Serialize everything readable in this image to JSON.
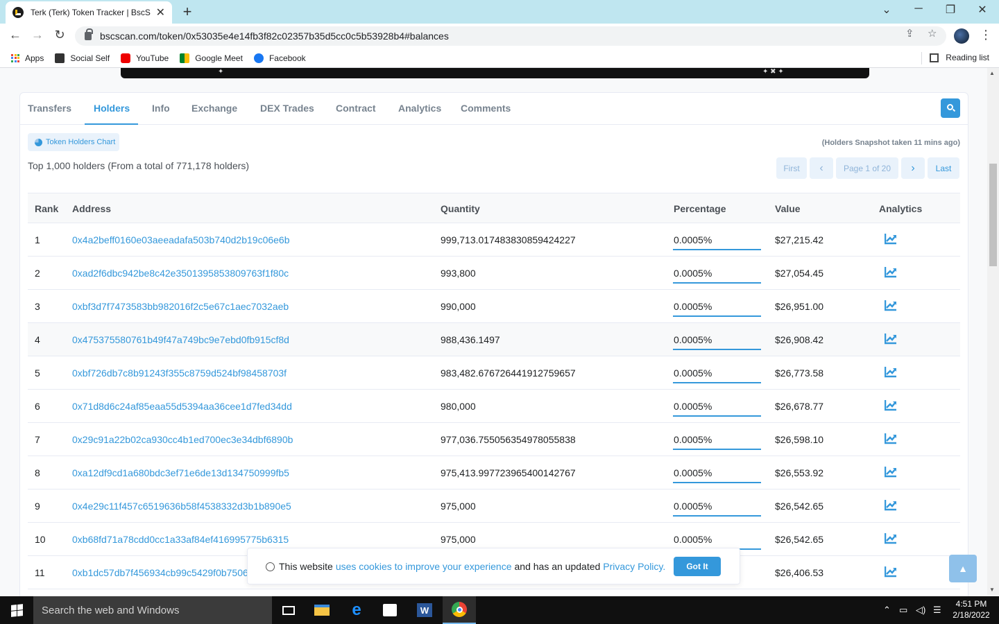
{
  "browser": {
    "tab_title": "Terk (Terk) Token Tracker | BscScan",
    "new_tab": "+",
    "close_tab": "✕",
    "url": "bscscan.com/token/0x53035e4e14fb3f82c02357b35d5cc0c5b53928b4#balances",
    "bookmarks": [
      {
        "label": "Apps"
      },
      {
        "label": "Social Self"
      },
      {
        "label": "YouTube"
      },
      {
        "label": "Google Meet"
      },
      {
        "label": "Facebook"
      }
    ],
    "reading_list": "Reading list"
  },
  "page_tabs": [
    "Transfers",
    "Holders",
    "Info",
    "Exchange",
    "DEX Trades",
    "Contract",
    "Analytics",
    "Comments"
  ],
  "active_tab": "Holders",
  "holders": {
    "chart_button": "Token Holders Chart",
    "snapshot_note": "(Holders Snapshot taken 11 mins ago)",
    "total_text": "Top 1,000 holders (From a total of 771,178 holders)",
    "pagination": {
      "first": "First",
      "prev": "‹",
      "page": "Page 1 of 20",
      "next": "›",
      "last": "Last"
    },
    "columns": [
      "Rank",
      "Address",
      "Quantity",
      "Percentage",
      "Value",
      "Analytics"
    ],
    "rows": [
      {
        "rank": "1",
        "address": "0x4a2beff0160e03aeeadafa503b740d2b19c06e6b",
        "quantity": "999,713.017483830859424227",
        "percentage": "0.0005%",
        "value": "$27,215.42"
      },
      {
        "rank": "2",
        "address": "0xad2f6dbc942be8c42e3501395853809763f1f80c",
        "quantity": "993,800",
        "percentage": "0.0005%",
        "value": "$27,054.45"
      },
      {
        "rank": "3",
        "address": "0xbf3d7f7473583bb982016f2c5e67c1aec7032aeb",
        "quantity": "990,000",
        "percentage": "0.0005%",
        "value": "$26,951.00"
      },
      {
        "rank": "4",
        "address": "0x475375580761b49f47a749bc9e7ebd0fb915cf8d",
        "quantity": "988,436.1497",
        "percentage": "0.0005%",
        "value": "$26,908.42"
      },
      {
        "rank": "5",
        "address": "0xbf726db7c8b91243f355c8759d524bf98458703f",
        "quantity": "983,482.676726441912759657",
        "percentage": "0.0005%",
        "value": "$26,773.58"
      },
      {
        "rank": "6",
        "address": "0x71d8d6c24af85eaa55d5394aa36cee1d7fed34dd",
        "quantity": "980,000",
        "percentage": "0.0005%",
        "value": "$26,678.77"
      },
      {
        "rank": "7",
        "address": "0x29c91a22b02ca930cc4b1ed700ec3e34dbf6890b",
        "quantity": "977,036.755056354978055838",
        "percentage": "0.0005%",
        "value": "$26,598.10"
      },
      {
        "rank": "8",
        "address": "0xa12df9cd1a680bdc3ef71e6de13d134750999fb5",
        "quantity": "975,413.997723965400142767",
        "percentage": "0.0005%",
        "value": "$26,553.92"
      },
      {
        "rank": "9",
        "address": "0x4e29c11f457c6519636b58f4538332d3b1b890e5",
        "quantity": "975,000",
        "percentage": "0.0005%",
        "value": "$26,542.65"
      },
      {
        "rank": "10",
        "address": "0xb68fd71a78cdd0cc1a33af84ef416995775b6315",
        "quantity": "975,000",
        "percentage": "0.0005%",
        "value": "$26,542.65"
      },
      {
        "rank": "11",
        "address": "0xb1dc57db7f456934cb99c5429f0b7506",
        "quantity": "",
        "percentage": "",
        "value": "$26,406.53"
      }
    ]
  },
  "cookie": {
    "text_before": "This website",
    "link1": "uses cookies to improve your experience",
    "text_middle": "and has an updated",
    "link2": "Privacy Policy.",
    "button": "Got It"
  },
  "taskbar": {
    "search_placeholder": "Search the web and Windows",
    "time": "4:51 PM",
    "date": "2/18/2022"
  },
  "colors": {
    "accent": "#3498db",
    "taskbar": "#101010",
    "tabbar": "#bfe6f0"
  }
}
